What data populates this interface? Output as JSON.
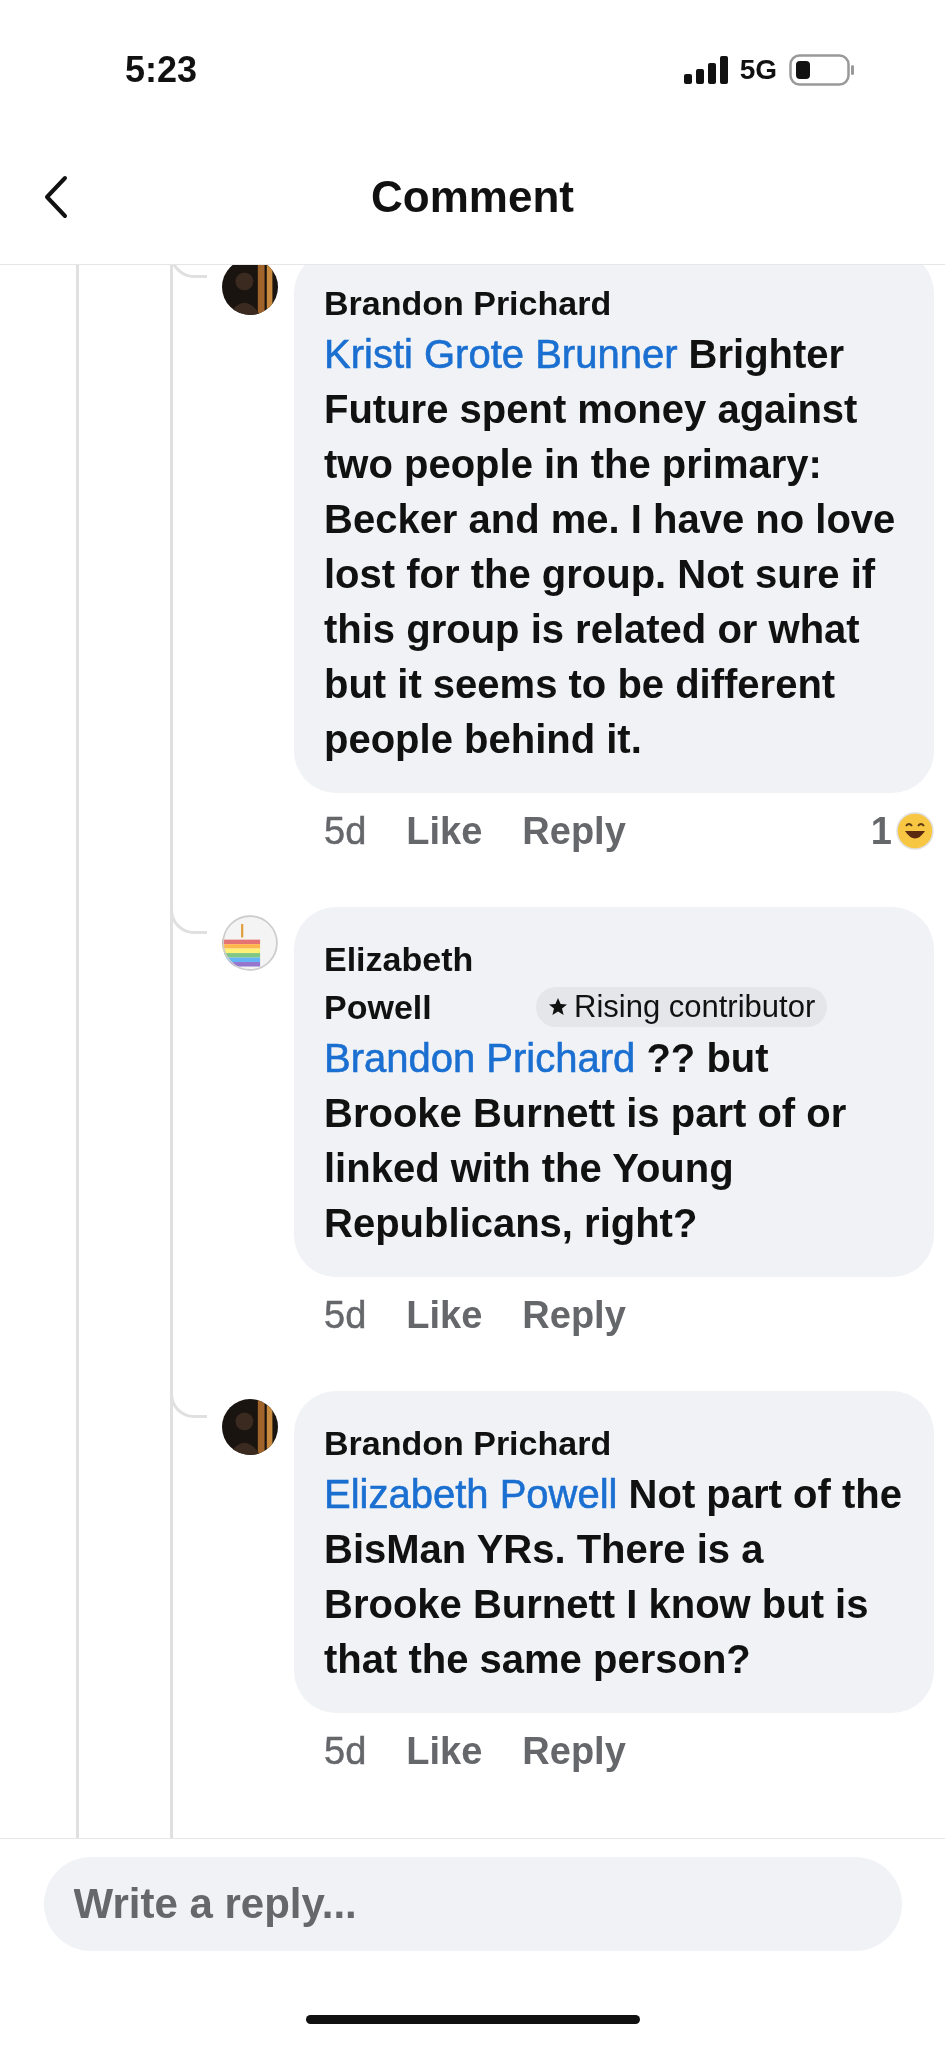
{
  "status_bar": {
    "time": "5:23",
    "network": "5G"
  },
  "header": {
    "title": "Comment"
  },
  "comments": [
    {
      "author": "Brandon Prichard",
      "avatar": {
        "kind": "photo"
      },
      "mention": "Kristi Grote Brunner",
      "text": "Brighter Future spent money against two people in the primary: Becker and me. I have no love lost for the group. Not sure if this group is related or what but it seems to be different people behind it.",
      "time": "5d",
      "like": "Like",
      "reply": "Reply",
      "reaction_count": "1"
    },
    {
      "author": "Elizabeth Powell",
      "avatar": {
        "kind": "stripes"
      },
      "badge": "Rising contributor",
      "mention": "Brandon Prichard",
      "text": "??  but Brooke Burnett is part of or linked with the Young Republicans, right?",
      "time": "5d",
      "like": "Like",
      "reply": "Reply"
    },
    {
      "author": "Brandon Prichard",
      "avatar": {
        "kind": "photo"
      },
      "mention": "Elizabeth Powell",
      "text": "Not part of the BisMan YRs. There is a Brooke Burnett I know but is that the same person?",
      "time": "5d",
      "like": "Like",
      "reply": "Reply"
    }
  ],
  "composer": {
    "placeholder": "Write a reply..."
  }
}
